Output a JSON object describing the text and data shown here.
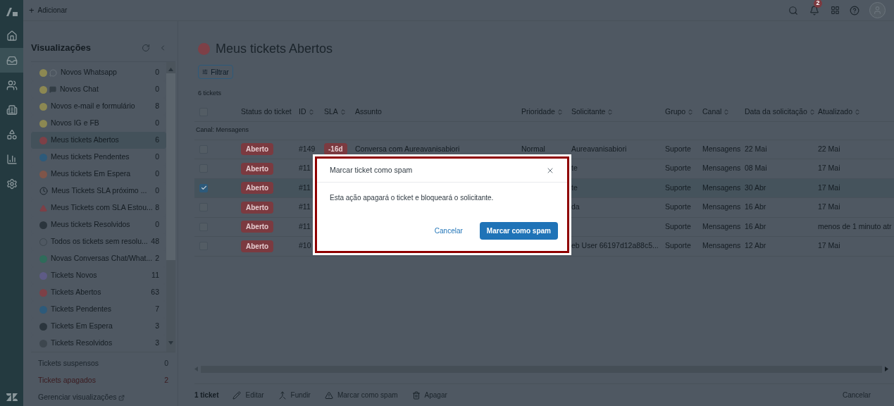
{
  "top_bar": {
    "add_icon": "+",
    "add_label": "Adicionar",
    "notification_count": "2"
  },
  "nav": [
    {
      "kind": "home",
      "selected": false
    },
    {
      "kind": "tickets",
      "selected": true
    },
    {
      "kind": "users",
      "selected": false
    },
    {
      "kind": "organizations",
      "selected": false
    },
    {
      "kind": "objects",
      "selected": false
    },
    {
      "kind": "reports",
      "selected": false
    },
    {
      "kind": "settings",
      "selected": false
    }
  ],
  "views": {
    "title": "Visualizações",
    "items": [
      {
        "label": "Novos Whatsapp",
        "count": "0",
        "kind": "dot-bubble",
        "color": "#8c8852",
        "selected": false
      },
      {
        "label": "Novos Chat",
        "count": "0",
        "kind": "dot-chat",
        "color": "#8c8852",
        "selected": false
      },
      {
        "label": "Novos e-mail e formulário",
        "count": "8",
        "kind": "dot",
        "color": "#8c8852",
        "selected": false
      },
      {
        "label": "Novos IG e FB",
        "count": "0",
        "kind": "dot",
        "color": "#8c8852",
        "selected": false
      },
      {
        "label": "Meus tickets Abertos",
        "count": "6",
        "kind": "dot",
        "color": "#7d4047",
        "selected": true
      },
      {
        "label": "Meus tickets Pendentes",
        "count": "0",
        "kind": "dot",
        "color": "#2d5a7a",
        "selected": false
      },
      {
        "label": "Meus tickets Em Espera",
        "count": "0",
        "kind": "dot",
        "color": "#7f5549",
        "selected": false
      },
      {
        "label": "Meus Tickets SLA próximo ...",
        "count": "0",
        "kind": "clock",
        "selected": false
      },
      {
        "label": "Meus Tickets com SLA Estou...",
        "count": "8",
        "kind": "alert",
        "selected": false
      },
      {
        "label": "Meus tickets Resolvidos",
        "count": "0",
        "kind": "dot",
        "color": "#2b353d",
        "selected": false
      },
      {
        "label": "Todos os tickets sem resolu...",
        "count": "48",
        "kind": "ring",
        "selected": false
      },
      {
        "label": "Novas Conversas Chat/What...",
        "count": "2",
        "kind": "dot",
        "color": "#2f6b5a",
        "selected": false
      },
      {
        "label": "Tickets Novos",
        "count": "11",
        "kind": "dot",
        "color": "#5e5b86",
        "selected": false
      },
      {
        "label": "Tickets Abertos",
        "count": "63",
        "kind": "dot",
        "color": "#7d4047",
        "selected": false
      },
      {
        "label": "Tickets Pendentes",
        "count": "7",
        "kind": "dot",
        "color": "#2d5a7a",
        "selected": false
      },
      {
        "label": "Tickets Em Espera",
        "count": "3",
        "kind": "dot",
        "color": "#2b353d",
        "selected": false
      },
      {
        "label": "Tickets Resolvidos",
        "count": "3",
        "kind": "dot",
        "color": "#3d464e",
        "selected": false
      }
    ],
    "extra": [
      {
        "label": "Tickets suspensos",
        "count": "0",
        "kind": "normal"
      },
      {
        "label": "Tickets apagados",
        "count": "2",
        "kind": "danger"
      }
    ],
    "manage_link": "Gerenciar visualizações"
  },
  "main": {
    "title": "Meus tickets Abertos",
    "filter_label": "Filtrar",
    "count_label": "6 tickets"
  },
  "table": {
    "columns": [
      {
        "label": "Status do ticket",
        "sortable": false
      },
      {
        "label": "ID",
        "sortable": true
      },
      {
        "label": "SLA",
        "sortable": true
      },
      {
        "label": "Assunto",
        "sortable": false
      },
      {
        "label": "Prioridade",
        "sortable": true
      },
      {
        "label": "Solicitante",
        "sortable": true
      },
      {
        "label": "Grupo",
        "sortable": true
      },
      {
        "label": "Canal",
        "sortable": true
      },
      {
        "label": "Data da solicitação",
        "sortable": true
      },
      {
        "label": "Atualizado",
        "sortable": true
      }
    ],
    "select_all_checked": false,
    "group_label": "Canal: Mensagens",
    "rows": [
      {
        "selected": false,
        "cells": [
          "Aberto",
          "#149",
          "-16d",
          "Conversa com Aureavanisabiori",
          "Normal",
          "Aureavanisabiori",
          "Suporte",
          "Mensagens",
          "22 Mai",
          "22 Mai"
        ]
      },
      {
        "selected": false,
        "cells": [
          "Aberto",
          "#11",
          null,
          null,
          null,
          "te",
          "Suporte",
          "Mensagens",
          "08 Mai",
          "17 Mai"
        ]
      },
      {
        "selected": true,
        "cells": [
          "Aberto",
          "#11",
          null,
          null,
          null,
          "te",
          "Suporte",
          "Mensagens",
          "30 Abr",
          "17 Mai"
        ]
      },
      {
        "selected": false,
        "cells": [
          "Aberto",
          "#11",
          null,
          null,
          null,
          "da",
          "Suporte",
          "Mensagens",
          "16 Abr",
          "17 Mai"
        ]
      },
      {
        "selected": false,
        "cells": [
          "Aberto",
          "#11",
          null,
          null,
          null,
          null,
          "Suporte",
          "Mensagens",
          "16 Abr",
          "menos de 1 minuto atr"
        ]
      },
      {
        "selected": false,
        "cells": [
          "Aberto",
          "#10",
          null,
          null,
          null,
          "eb User 66197d12a88c5...",
          "Suporte",
          "Mensagens",
          "12 Abr",
          "17 Mai"
        ]
      }
    ]
  },
  "bulk_actions": {
    "count": "1 ticket",
    "actions": [
      {
        "label": "Editar",
        "kind": "edit"
      },
      {
        "label": "Fundir",
        "kind": "merge"
      },
      {
        "label": "Marcar como spam",
        "kind": "spam"
      },
      {
        "label": "Apagar",
        "kind": "delete"
      }
    ],
    "cancel": "Cancelar"
  },
  "dialog": {
    "title": "Marcar ticket como spam",
    "message": "Esta ação apagará o ticket e bloqueará o solicitante.",
    "cancel": "Cancelar",
    "confirm": "Marcar como spam"
  }
}
